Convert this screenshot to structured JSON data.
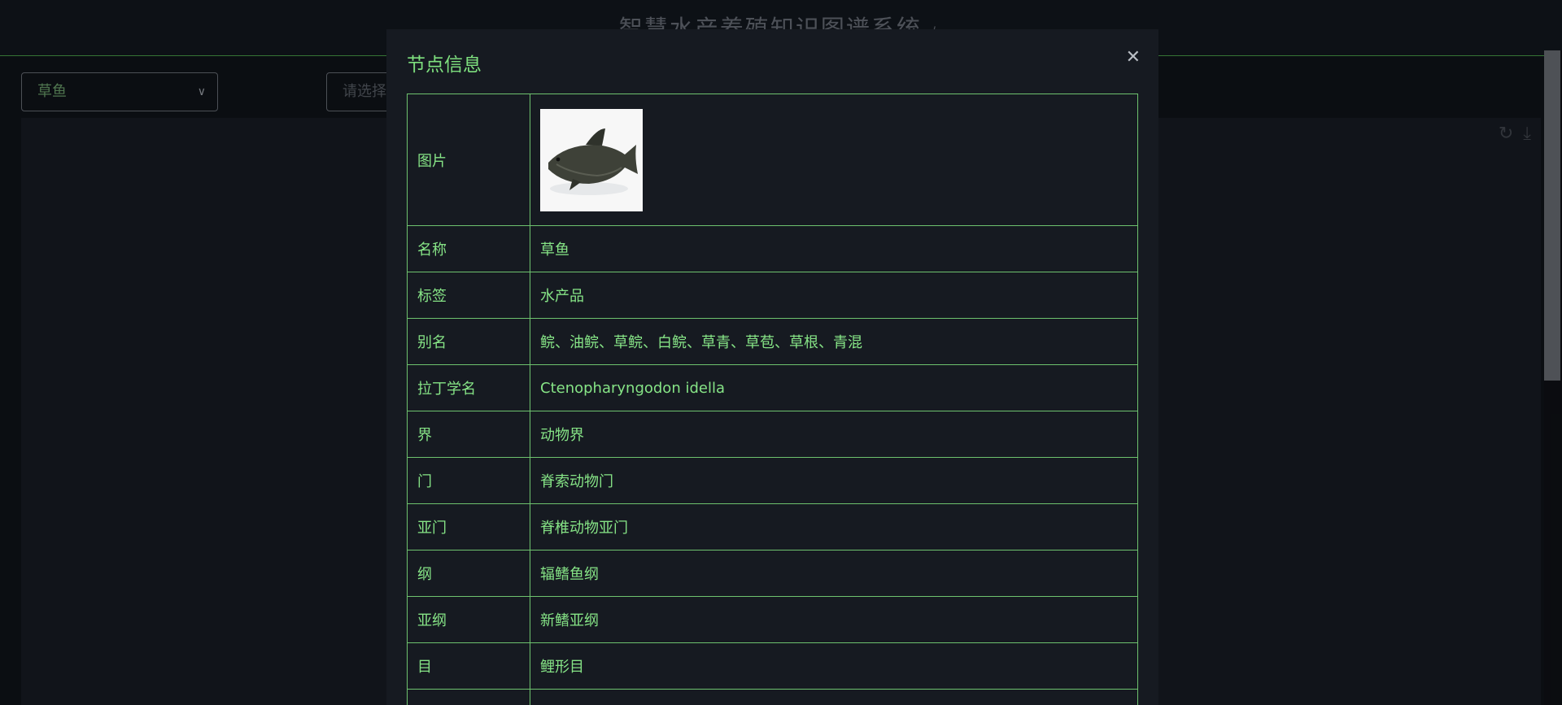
{
  "app": {
    "title": "智慧水产养殖知识图谱系统",
    "share_icon": "share-icon"
  },
  "toolbar": {
    "node_select_value": "草鱼",
    "relation_select_placeholder": "请选择"
  },
  "graph_tools": [
    "refresh-icon",
    "download-icon"
  ],
  "modal": {
    "title": "节点信息",
    "close_icon": "close-icon",
    "rows": [
      {
        "key": "图片",
        "value": ""
      },
      {
        "key": "名称",
        "value": "草鱼"
      },
      {
        "key": "标签",
        "value": "水产品"
      },
      {
        "key": "别名",
        "value": "鲩、油鲩、草鲩、白鲩、草青、草苞、草根、青混"
      },
      {
        "key": "拉丁学名",
        "value": "Ctenopharyngodon idella"
      },
      {
        "key": "界",
        "value": "动物界"
      },
      {
        "key": "门",
        "value": "脊索动物门"
      },
      {
        "key": "亚门",
        "value": "脊椎动物亚门"
      },
      {
        "key": "纲",
        "value": "辐鳍鱼纲"
      },
      {
        "key": "亚纲",
        "value": "新鳍亚纲"
      },
      {
        "key": "目",
        "value": "鲤形目"
      }
    ]
  },
  "colors": {
    "accent": "#7ee07e",
    "table_border": "#6ec26e",
    "modal_bg": "#161a21"
  }
}
